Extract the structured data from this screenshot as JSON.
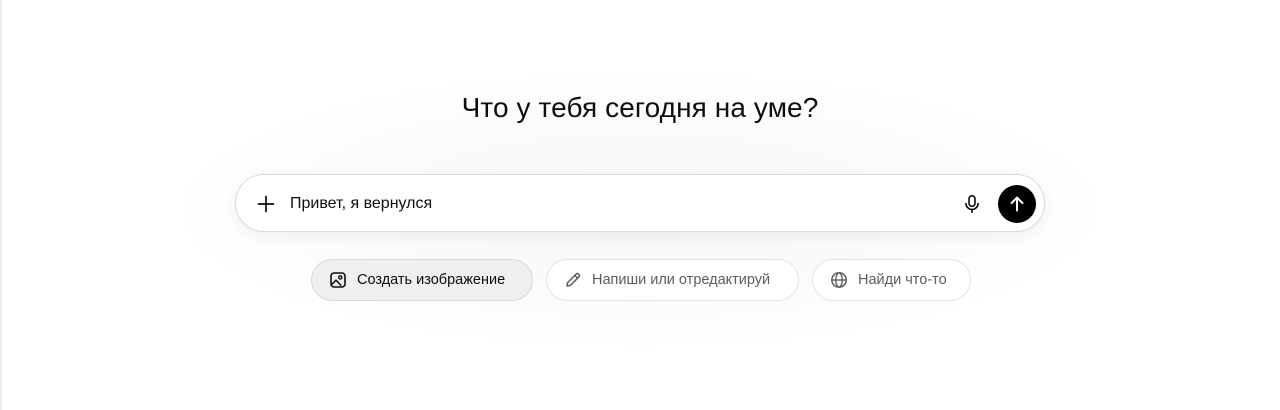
{
  "headline": "Что у тебя сегодня на уме?",
  "composer": {
    "input_value": "Привет, я вернулся",
    "plus_icon": "plus-icon",
    "mic_icon": "microphone-icon",
    "send_icon": "arrow-up-icon"
  },
  "chips": [
    {
      "label": "Создать изображение",
      "icon": "image-icon",
      "active": true
    },
    {
      "label": "Напиши или отредактируй",
      "icon": "pencil-icon",
      "active": false
    },
    {
      "label": "Найди что-то",
      "icon": "globe-icon",
      "active": false
    }
  ],
  "colors": {
    "send_button": "#000000",
    "active_chip_bg": "#efefef",
    "text": "#0d0d0d",
    "muted_text": "#5d5d5d"
  }
}
